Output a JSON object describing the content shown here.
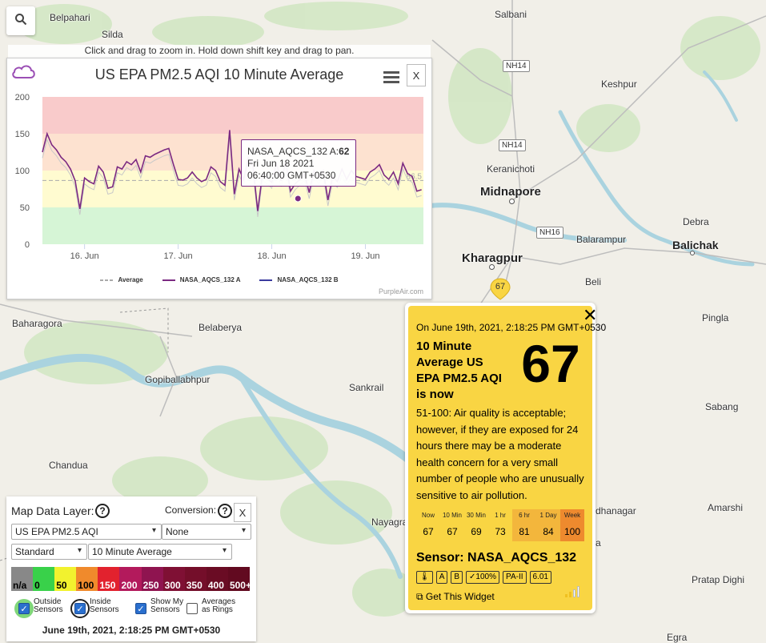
{
  "map": {
    "places": [
      {
        "name": "Belpahari",
        "big": false
      },
      {
        "name": "Silda",
        "big": false
      },
      {
        "name": "Salbani",
        "big": false
      },
      {
        "name": "Keshpur",
        "big": false
      },
      {
        "name": "Keranichoti",
        "big": false
      },
      {
        "name": "Midnapore",
        "big": true
      },
      {
        "name": "Kharagpur",
        "big": true
      },
      {
        "name": "Balarampur",
        "big": false
      },
      {
        "name": "Debra",
        "big": false
      },
      {
        "name": "Balichak",
        "big": false
      },
      {
        "name": "Beli",
        "big": false
      },
      {
        "name": "Pingla",
        "big": false
      },
      {
        "name": "Baharagora",
        "big": false
      },
      {
        "name": "Belaberya",
        "big": false
      },
      {
        "name": "Gopiballabhpur",
        "big": false
      },
      {
        "name": "Sankrail",
        "big": false
      },
      {
        "name": "Sabang",
        "big": false
      },
      {
        "name": "Chandua",
        "big": false
      },
      {
        "name": "Nayagra",
        "big": false
      },
      {
        "name": "dhanagar",
        "big": false
      },
      {
        "name": "Amarshi",
        "big": false
      },
      {
        "name": "Pratap Dighi",
        "big": false
      },
      {
        "name": "Egra",
        "big": false
      },
      {
        "name": "a",
        "big": false
      }
    ],
    "roads": [
      "NH14",
      "NH14",
      "NH16"
    ],
    "sensor_marker": {
      "value": "67",
      "color": "#f9d543"
    },
    "zoom_hint": "Click and drag to zoom in. Hold down shift key and drag to pan."
  },
  "chart_panel": {
    "title": "US EPA PM2.5 AQI 10 Minute Average",
    "close_label": "X",
    "credit": "PurpleAir.com",
    "average_label": "86.5",
    "tooltip": {
      "series": "NASA_AQCS_132 A:",
      "value": "62",
      "date": "Fri Jun 18 2021",
      "time": "06:40:00 GMT+0530"
    }
  },
  "chart_data": {
    "type": "line",
    "title": "US EPA PM2.5 AQI 10 Minute Average",
    "xlabel": "",
    "ylabel": "",
    "ylim": [
      0,
      200
    ],
    "yticks": [
      0,
      50,
      100,
      150,
      200
    ],
    "xticks": [
      "16. Jun",
      "17. Jun",
      "18. Jun",
      "19. Jun"
    ],
    "x_range_days": [
      15.55,
      19.62
    ],
    "bands": [
      {
        "from": 0,
        "to": 50,
        "color": "#d6f5d6"
      },
      {
        "from": 50,
        "to": 100,
        "color": "#fffbd0"
      },
      {
        "from": 100,
        "to": 150,
        "color": "#fde2d0"
      },
      {
        "from": 150,
        "to": 200,
        "color": "#f9cbcb"
      }
    ],
    "average_value": 86.5,
    "series": [
      {
        "name": "Average",
        "color": "#aaaaaa",
        "dashed": true
      },
      {
        "name": "NASA_AQCS_132 A",
        "color": "#7b2a82",
        "x": [
          15.55,
          15.6,
          15.65,
          15.7,
          15.75,
          15.8,
          15.85,
          15.9,
          15.95,
          16.0,
          16.05,
          16.1,
          16.15,
          16.2,
          16.25,
          16.3,
          16.35,
          16.4,
          16.45,
          16.5,
          16.55,
          16.6,
          16.65,
          16.7,
          16.75,
          16.8,
          16.85,
          16.9,
          16.95,
          17.0,
          17.05,
          17.1,
          17.15,
          17.2,
          17.25,
          17.3,
          17.35,
          17.4,
          17.45,
          17.5,
          17.55,
          17.6,
          17.65,
          17.7,
          17.75,
          17.8,
          17.85,
          17.9,
          17.95,
          18.0,
          18.05,
          18.1,
          18.15,
          18.2,
          18.25,
          18.3,
          18.35,
          18.4,
          18.45,
          18.5,
          18.55,
          18.6,
          18.65,
          18.7,
          18.75,
          18.8,
          18.85,
          18.9,
          18.95,
          19.0,
          19.05,
          19.1,
          19.15,
          19.2,
          19.25,
          19.3,
          19.35,
          19.4,
          19.45,
          19.5,
          19.55,
          19.6
        ],
        "values": [
          125,
          150,
          135,
          128,
          118,
          112,
          102,
          86,
          48,
          90,
          85,
          82,
          106,
          98,
          76,
          78,
          105,
          102,
          112,
          108,
          115,
          98,
          120,
          118,
          122,
          125,
          128,
          130,
          108,
          88,
          87,
          90,
          98,
          90,
          85,
          88,
          105,
          100,
          85,
          80,
          155,
          68,
          102,
          88,
          118,
          105,
          45,
          95,
          90,
          84,
          110,
          86,
          112,
          72,
          82,
          88,
          95,
          70,
          100,
          90,
          100,
          60,
          92,
          85,
          102,
          88,
          100,
          92,
          90,
          88,
          98,
          102,
          108,
          94,
          88,
          98,
          82,
          110,
          96,
          92,
          72,
          74
        ]
      },
      {
        "name": "NASA_AQCS_132 B",
        "color": "#3b3b9e",
        "dashed": false
      }
    ]
  },
  "popup": {
    "close_label": "✕",
    "date": "On June 19th, 2021, 2:18:25 PM GMT+0530",
    "heading": "10 Minute Average US EPA PM2.5 AQI is now",
    "value": "67",
    "description": "51-100: Air quality is acceptable; however, if they are exposed for 24 hours there may be a moderate health concern for a very small number of people who are unusually sensitive to air pollution.",
    "stats": [
      {
        "label": "Now",
        "value": "67",
        "color": "#f9d543"
      },
      {
        "label": "10 Min",
        "value": "67",
        "color": "#f9d543"
      },
      {
        "label": "30 Min",
        "value": "69",
        "color": "#f9d543"
      },
      {
        "label": "1 hr",
        "value": "73",
        "color": "#f9d543"
      },
      {
        "label": "6 hr",
        "value": "81",
        "color": "#f3b63c"
      },
      {
        "label": "1 Day",
        "value": "84",
        "color": "#f3b63c"
      },
      {
        "label": "Week",
        "value": "100",
        "color": "#ee8a2e"
      }
    ],
    "sensor_name": "Sensor: NASA_AQCS_132",
    "badges": [
      "🌡",
      "A",
      "B",
      "✓100%",
      "PA-II",
      "6.01"
    ],
    "widget_link": "Get This Widget"
  },
  "controls": {
    "layer_label": "Map Data Layer:",
    "conversion_label": "Conversion:",
    "close_label": "X",
    "layer_value": "US EPA PM2.5 AQI",
    "conversion_value": "None",
    "scheme_value": "Standard",
    "average_value": "10 Minute Average",
    "scale": [
      {
        "label": "n/a",
        "color": "#888888",
        "text": "#000"
      },
      {
        "label": "0",
        "color": "#39d14a",
        "text": "#000"
      },
      {
        "label": "50",
        "color": "#f2f22e",
        "text": "#000"
      },
      {
        "label": "100",
        "color": "#f08a2c",
        "text": "#000"
      },
      {
        "label": "150",
        "color": "#e2222e",
        "text": "#fff"
      },
      {
        "label": "200",
        "color": "#b31a5c",
        "text": "#fff"
      },
      {
        "label": "250",
        "color": "#8f1450",
        "text": "#fff"
      },
      {
        "label": "300",
        "color": "#7f1034",
        "text": "#fff"
      },
      {
        "label": "350",
        "color": "#740e2a",
        "text": "#fff"
      },
      {
        "label": "400",
        "color": "#6a0c24",
        "text": "#fff"
      },
      {
        "label": "500+",
        "color": "#620a20",
        "text": "#fff"
      }
    ],
    "checks": [
      {
        "label1": "Outside",
        "label2": "Sensors",
        "checked": true
      },
      {
        "label1": "Inside",
        "label2": "Sensors",
        "checked": true
      },
      {
        "label1": "Show My",
        "label2": "Sensors",
        "checked": true
      },
      {
        "label1": "Averages",
        "label2": "as Rings",
        "checked": false
      }
    ],
    "date": "June 19th, 2021, 2:18:25 PM GMT+0530"
  }
}
